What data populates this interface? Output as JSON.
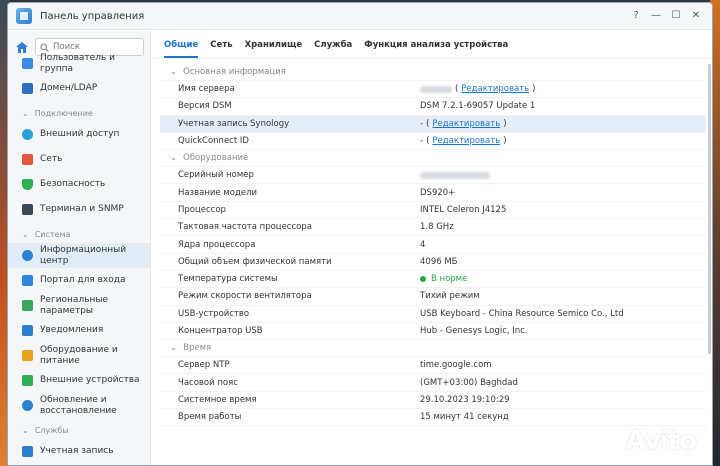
{
  "window": {
    "title": "Панель управления"
  },
  "controls": {
    "help": "?",
    "minimize": "—",
    "maximize": "☐",
    "close": "✕"
  },
  "search": {
    "placeholder": "Поиск"
  },
  "sidebar": {
    "top_partial": "Пользователь и группа",
    "item_domain": "Домен/LDAP",
    "section_connect": "Подключение",
    "item_external": "Внешний доступ",
    "item_network": "Сеть",
    "item_security": "Безопасность",
    "item_terminal": "Терминал и SNMP",
    "section_system": "Система",
    "item_info_1": "Информационный",
    "item_info_2": "центр",
    "item_portal": "Портал для входа",
    "item_regional_1": "Региональные",
    "item_regional_2": "параметры",
    "item_notifications": "Уведомления",
    "item_power_1": "Оборудование и",
    "item_power_2": "питание",
    "item_external_dev": "Внешние устройства",
    "item_update_1": "Обновление и",
    "item_update_2": "восстановление",
    "section_services": "Службы",
    "bottom_partial": "Учетная запись"
  },
  "tabs": [
    "Общие",
    "Сеть",
    "Хранилище",
    "Служба",
    "Функция анализа устройства"
  ],
  "groups": {
    "basic": "Основная информация",
    "hardware": "Оборудование",
    "time": "Время"
  },
  "rows": {
    "server_name": {
      "key": "Имя сервера",
      "link": "Редактировать"
    },
    "dsm_version": {
      "key": "Версия DSM",
      "value": "DSM 7.2.1-69057 Update 1"
    },
    "synology_account": {
      "key": "Учетная запись Synology",
      "value": "-",
      "link": "Редактировать"
    },
    "quickconnect": {
      "key": "QuickConnect ID",
      "value": "-",
      "link": "Редактировать"
    },
    "serial": {
      "key": "Серийный номер"
    },
    "model": {
      "key": "Название модели",
      "value": "DS920+"
    },
    "cpu": {
      "key": "Процессор",
      "value": "INTEL Celeron J4125"
    },
    "cpu_freq": {
      "key": "Тактовая частота процессора",
      "value": "1.8 GHz"
    },
    "cpu_cores": {
      "key": "Ядра процессора",
      "value": "4"
    },
    "memory": {
      "key": "Общий объем физической памяти",
      "value": "4096 МБ"
    },
    "temperature": {
      "key": "Температура системы",
      "value": "В норме"
    },
    "fan": {
      "key": "Режим скорости вентилятора",
      "value": "Тихий режим"
    },
    "usb_device": {
      "key": "USB-устройство",
      "value": "USB Keyboard - China Resource Semico Co., Ltd"
    },
    "usb_hub": {
      "key": "Концентратор USB",
      "value": "Hub - Genesys Logic, Inc."
    },
    "ntp": {
      "key": "Сервер NTP",
      "value": "time.google.com"
    },
    "timezone": {
      "key": "Часовой пояс",
      "value": "(GMT+03:00) Baghdad"
    },
    "system_time": {
      "key": "Системное время",
      "value": "29.10.2023 19:10:29"
    },
    "uptime": {
      "key": "Время работы",
      "value": "15 минут 41 секунд"
    }
  },
  "watermark": "Avito",
  "colors": {
    "accent": "#1b74d1",
    "status_ok": "#27a843",
    "highlight": "#e5eef8"
  }
}
